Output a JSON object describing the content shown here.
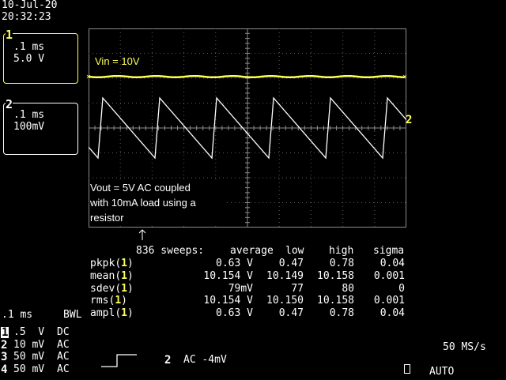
{
  "header": {
    "date": "10-Jul-20",
    "time": "20:32:23"
  },
  "ch1_panel": {
    "num": "1",
    "timebase": ".1 ms",
    "volts": "5.0 V"
  },
  "ch2_panel": {
    "num": "2",
    "timebase": ".1 ms",
    "volts": "100mV"
  },
  "annotations": {
    "vin": "Vin = 10V",
    "vout_lines": [
      "Vout = 5V AC coupled",
      "with 10mA load using a",
      "resistor"
    ]
  },
  "trace_marker": {
    "ch2": "2"
  },
  "stats": {
    "sweeps": "836 sweeps:",
    "headers": [
      "average",
      "low",
      "high",
      "sigma"
    ],
    "rows": [
      {
        "name": "pkpk",
        "ch": "1",
        "average": "0.63 V",
        "low": "0.47",
        "high": "0.78",
        "sigma": "0.04"
      },
      {
        "name": "mean",
        "ch": "1",
        "average": "10.154 V",
        "low": "10.149",
        "high": "10.158",
        "sigma": "0.001"
      },
      {
        "name": "sdev",
        "ch": "1",
        "average": "79mV",
        "low": "77",
        "high": "80",
        "sigma": "0"
      },
      {
        "name": "rms",
        "ch": "1",
        "average": "10.154 V",
        "low": "10.150",
        "high": "10.158",
        "sigma": "0.001"
      },
      {
        "name": "ampl",
        "ch": "1",
        "average": "0.63 V",
        "low": "0.47",
        "high": "0.78",
        "sigma": "0.04"
      }
    ]
  },
  "bottom": {
    "timebase": ".1 ms",
    "bwl": "BWL",
    "channels": [
      {
        "num": "1",
        "volts": ".5  V",
        "coupling": "DC"
      },
      {
        "num": "2",
        "volts": "10 mV",
        "coupling": "AC"
      },
      {
        "num": "3",
        "volts": "50 mV",
        "coupling": "AC"
      },
      {
        "num": "4",
        "volts": "50 mV",
        "coupling": "AC"
      }
    ],
    "trigger_ch": "2",
    "trigger_text": "AC -4mV",
    "sample_rate": "50 MS/s",
    "mode": "AUTO"
  },
  "colors": {
    "ch1": "#ffff55",
    "ch2": "#ffffff",
    "grid": "#8c8c8c"
  }
}
